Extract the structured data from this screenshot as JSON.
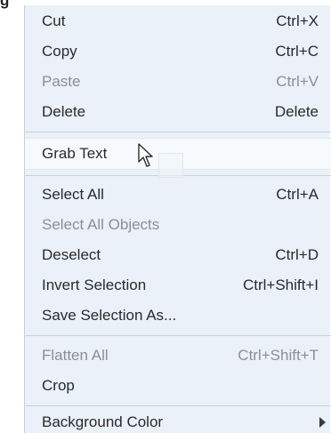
{
  "top_label": "g",
  "menu": {
    "items": [
      {
        "label": "Cut",
        "shortcut": "Ctrl+X",
        "disabled": false
      },
      {
        "label": "Copy",
        "shortcut": "Ctrl+C",
        "disabled": false
      },
      {
        "label": "Paste",
        "shortcut": "Ctrl+V",
        "disabled": true
      },
      {
        "label": "Delete",
        "shortcut": "Delete",
        "disabled": false
      },
      {
        "label": "Grab Text",
        "shortcut": "",
        "disabled": false,
        "hovered": true
      },
      {
        "label": "Select All",
        "shortcut": "Ctrl+A",
        "disabled": false
      },
      {
        "label": "Select All Objects",
        "shortcut": "",
        "disabled": true
      },
      {
        "label": "Deselect",
        "shortcut": "Ctrl+D",
        "disabled": false
      },
      {
        "label": "Invert Selection",
        "shortcut": "Ctrl+Shift+I",
        "disabled": false
      },
      {
        "label": "Save Selection As...",
        "shortcut": "",
        "disabled": false
      },
      {
        "label": "Flatten All",
        "shortcut": "Ctrl+Shift+T",
        "disabled": true
      },
      {
        "label": "Crop",
        "shortcut": "",
        "disabled": false
      },
      {
        "label": "Background Color",
        "shortcut": "",
        "disabled": false,
        "submenu": true
      }
    ]
  },
  "colors": {
    "menu_background": "#eaf1f9",
    "hover_background": "#f7fafd",
    "text": "#2a2a2a",
    "disabled_text": "#8c8f93",
    "separator": "#c9d3de"
  },
  "icons": {
    "cursor": "mouse-pointer-icon",
    "submenu": "triangle-right-icon"
  }
}
